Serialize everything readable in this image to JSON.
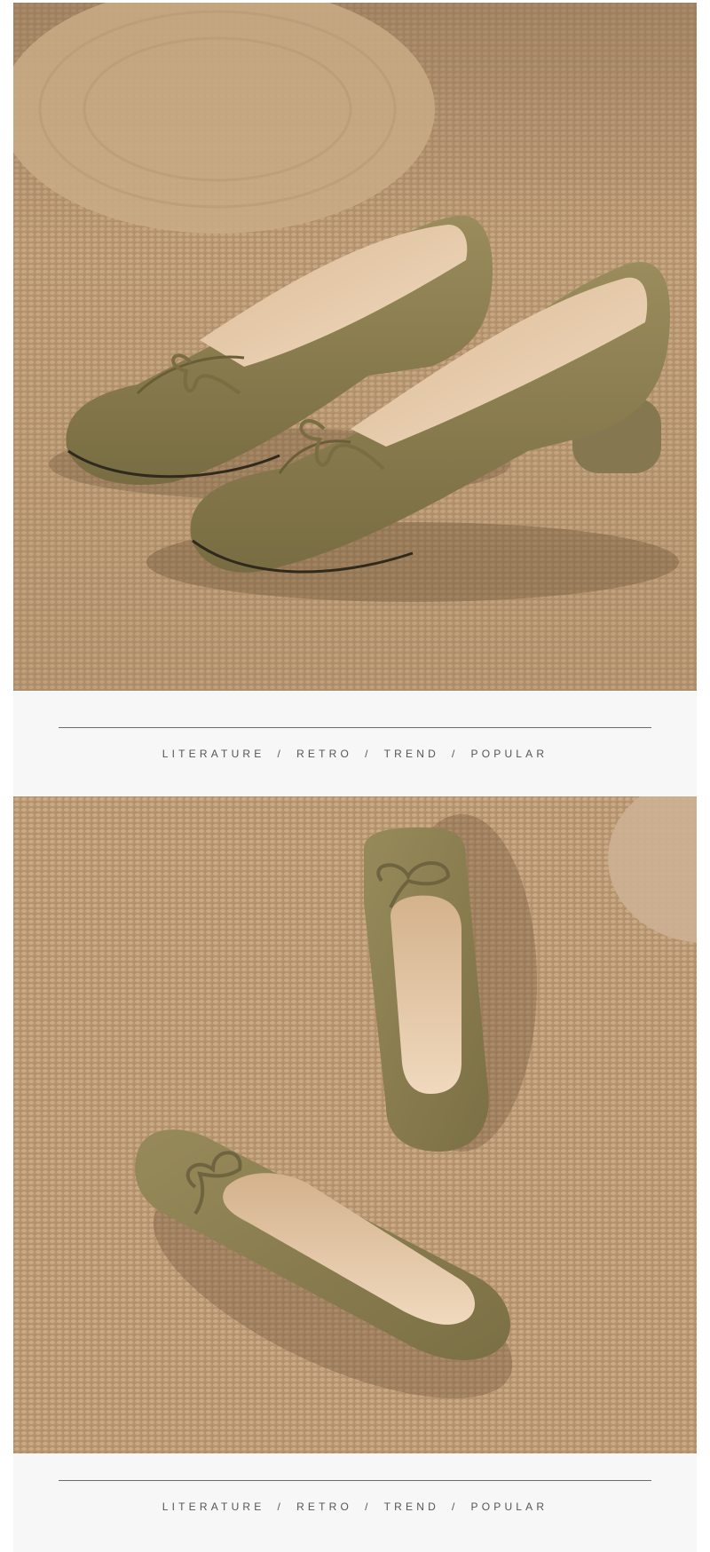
{
  "photo_1": {
    "description_icon": "olive-suede-bow-flats-side-view-photo"
  },
  "tagline_1": {
    "words": [
      "LITERATURE",
      "RETRO",
      "TREND",
      "POPULAR"
    ],
    "separator": "/"
  },
  "photo_2": {
    "description_icon": "olive-suede-bow-flats-top-view-photo"
  },
  "tagline_2": {
    "words": [
      "LITERATURE",
      "RETRO",
      "TREND",
      "POPULAR"
    ],
    "separator": "/"
  },
  "colors": {
    "band_background": "#f7f7f7",
    "rule": "#6b6b6b",
    "text": "#555555",
    "suede": "#8a7d4f",
    "carpet": "#b89a78",
    "lining": "#e9cfb0"
  }
}
